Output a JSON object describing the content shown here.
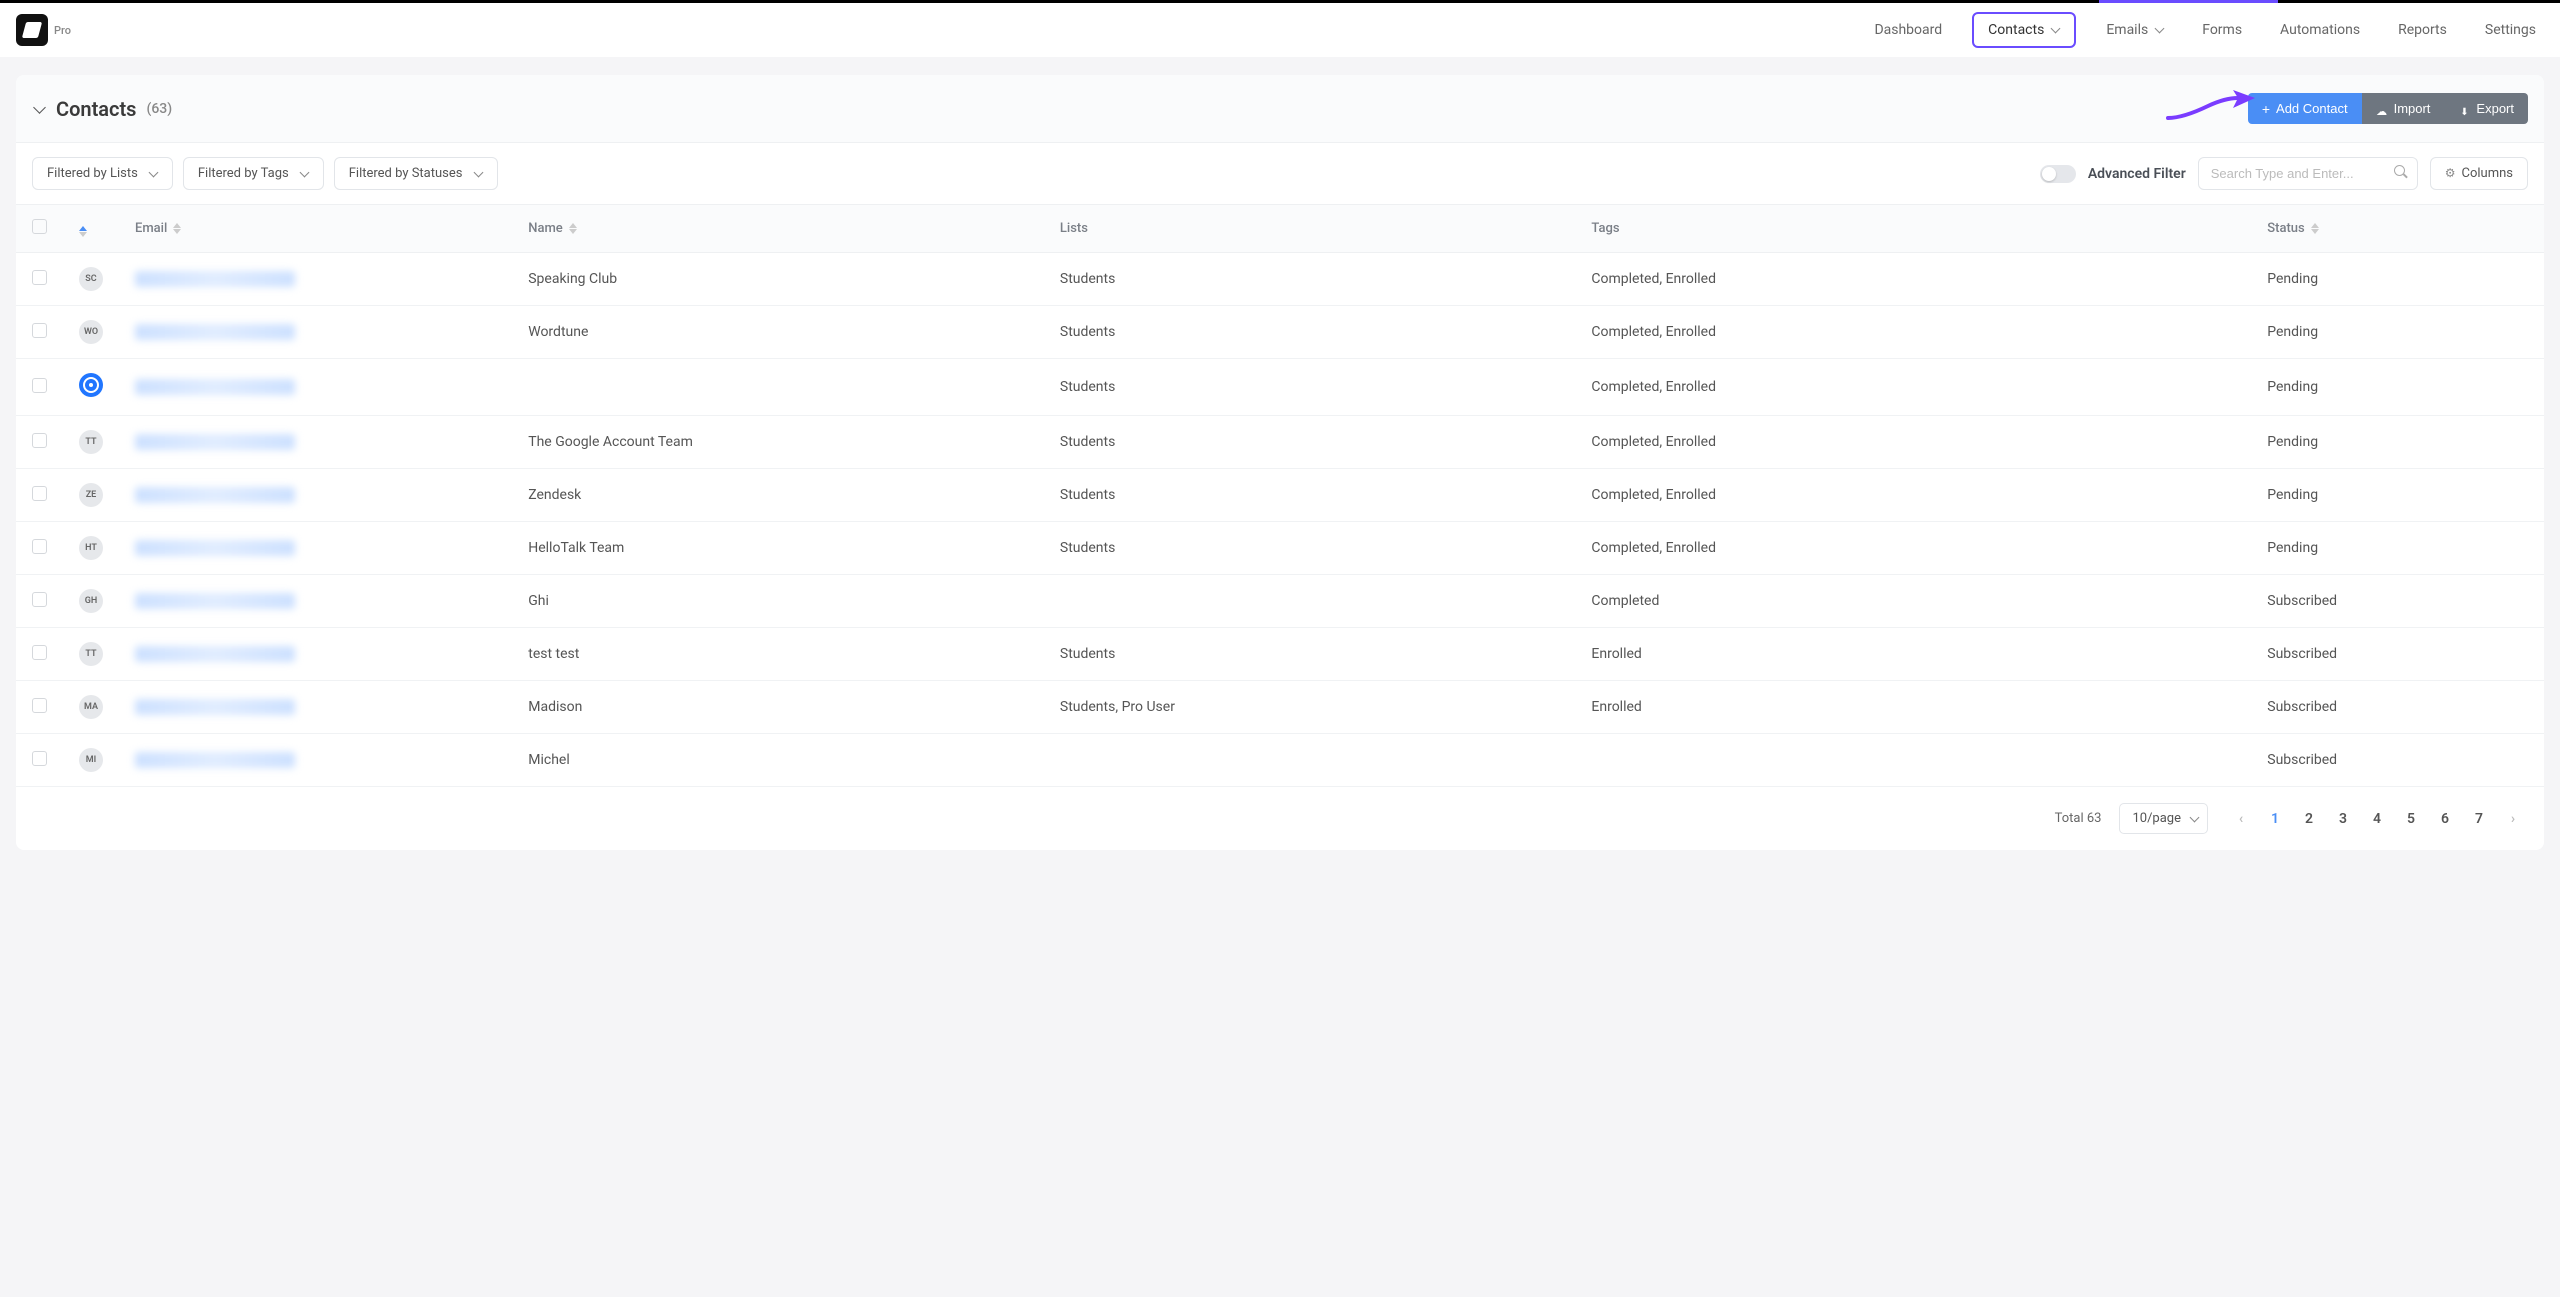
{
  "header": {
    "plan_label": "Pro",
    "nav": [
      {
        "label": "Dashboard",
        "active": false,
        "dropdown": false
      },
      {
        "label": "Contacts",
        "active": true,
        "dropdown": true
      },
      {
        "label": "Emails",
        "active": false,
        "dropdown": true
      },
      {
        "label": "Forms",
        "active": false,
        "dropdown": false
      },
      {
        "label": "Automations",
        "active": false,
        "dropdown": false
      },
      {
        "label": "Reports",
        "active": false,
        "dropdown": false
      },
      {
        "label": "Settings",
        "active": false,
        "dropdown": false
      }
    ]
  },
  "page_header": {
    "title": "Contacts",
    "count": "(63)",
    "add_label": "Add Contact",
    "import_label": "Import",
    "export_label": "Export"
  },
  "filters": {
    "lists": "Filtered by Lists",
    "tags": "Filtered by Tags",
    "statuses": "Filtered by Statuses",
    "advanced_label": "Advanced Filter",
    "search_placeholder": "Search Type and Enter...",
    "columns_label": "Columns"
  },
  "table": {
    "columns": {
      "email": "Email",
      "name": "Name",
      "lists": "Lists",
      "tags": "Tags",
      "status": "Status"
    },
    "rows": [
      {
        "avatar": "SC",
        "avatar_type": "text",
        "name": "Speaking Club",
        "lists": "Students",
        "tags": "Completed, Enrolled",
        "status": "Pending"
      },
      {
        "avatar": "WO",
        "avatar_type": "text",
        "name": "Wordtune",
        "lists": "Students",
        "tags": "Completed, Enrolled",
        "status": "Pending"
      },
      {
        "avatar": "",
        "avatar_type": "blue",
        "name": "",
        "lists": "Students",
        "tags": "Completed, Enrolled",
        "status": "Pending"
      },
      {
        "avatar": "TT",
        "avatar_type": "text",
        "name": "The Google Account Team",
        "lists": "Students",
        "tags": "Completed, Enrolled",
        "status": "Pending"
      },
      {
        "avatar": "ZE",
        "avatar_type": "text",
        "name": "Zendesk",
        "lists": "Students",
        "tags": "Completed, Enrolled",
        "status": "Pending"
      },
      {
        "avatar": "HT",
        "avatar_type": "text",
        "name": "HelloTalk Team",
        "lists": "Students",
        "tags": "Completed, Enrolled",
        "status": "Pending"
      },
      {
        "avatar": "GH",
        "avatar_type": "text",
        "name": "Ghi",
        "lists": "",
        "tags": "Completed",
        "status": "Subscribed"
      },
      {
        "avatar": "TT",
        "avatar_type": "text",
        "name": "test test",
        "lists": "Students",
        "tags": "Enrolled",
        "status": "Subscribed"
      },
      {
        "avatar": "MA",
        "avatar_type": "text",
        "name": "Madison",
        "lists": "Students, Pro User",
        "tags": "Enrolled",
        "status": "Subscribed"
      },
      {
        "avatar": "MI",
        "avatar_type": "text",
        "name": "Michel",
        "lists": "",
        "tags": "",
        "status": "Subscribed"
      }
    ]
  },
  "pagination": {
    "total": "Total 63",
    "page_size": "10/page",
    "pages": [
      "1",
      "2",
      "3",
      "4",
      "5",
      "6",
      "7"
    ],
    "active_page": "1"
  }
}
